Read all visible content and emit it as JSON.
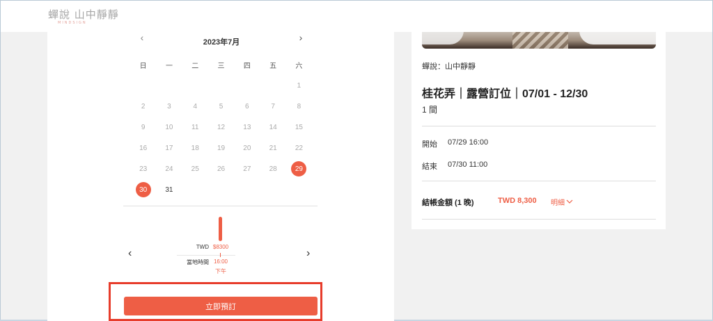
{
  "header": {
    "logo_main": "蟬說 山中靜靜",
    "logo_sub": "MINDSIGN"
  },
  "calendar": {
    "prev_icon": "‹",
    "next_icon": "›",
    "month_label": "2023年7月",
    "weekdays": [
      "日",
      "一",
      "二",
      "三",
      "四",
      "五",
      "六"
    ],
    "days": [
      "1",
      "2",
      "3",
      "4",
      "5",
      "6",
      "7",
      "8",
      "9",
      "10",
      "11",
      "12",
      "13",
      "14",
      "15",
      "16",
      "17",
      "18",
      "19",
      "20",
      "21",
      "22",
      "23",
      "24",
      "25",
      "26",
      "27",
      "28",
      "29",
      "30",
      "31"
    ],
    "selected_start": "29",
    "selected_end": "30"
  },
  "time_picker": {
    "prev_icon": "‹",
    "next_icon": "›",
    "currency_label": "TWD",
    "local_time_label": "當地時間",
    "price": "$8300",
    "time": "16:00",
    "ampm": "下午"
  },
  "book_button": "立即預訂",
  "summary": {
    "hotel_name": "蟬說：山中靜靜",
    "room_title": "桂花弄｜露營訂位｜07/01 - 12/30",
    "room_count": "1 間",
    "start_label": "開始",
    "start_value": "07/29 16:00",
    "end_label": "結束",
    "end_value": "07/30 11:00",
    "total_label": "結帳金額 (1 晚)",
    "total_value": "TWD 8,300",
    "detail_label": "明細",
    "detail_icon": "chevron-down-icon"
  },
  "colors": {
    "accent": "#ee5e45",
    "highlight_border": "#e73c2b",
    "background": "#f1f1f1"
  }
}
